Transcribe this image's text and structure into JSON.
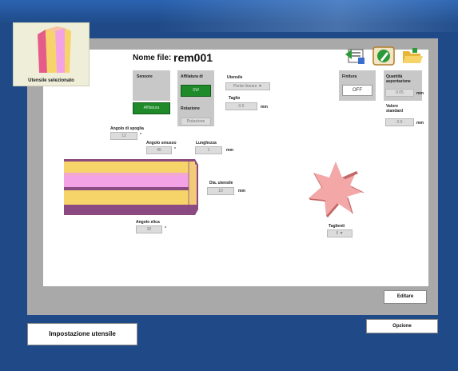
{
  "header": {
    "nome_file_label": "Nome file:",
    "nome_file_value": "rem001",
    "tool_thumb_caption": "Utensile selezionato"
  },
  "toolbar_icons": [
    "export-icon",
    "edit-icon",
    "folder-icon"
  ],
  "sensore": {
    "label": "Sensore",
    "button": "Affilatura"
  },
  "affilatura": {
    "label": "Affilatura di",
    "button": "SW"
  },
  "rotazione": {
    "label": "Rotazione",
    "value": "Rotazione"
  },
  "utensile": {
    "label": "Utensile",
    "value": "Punte lineare ▼"
  },
  "taglio": {
    "label": "Taglio",
    "value": "0.0",
    "unit": "mm"
  },
  "finitura": {
    "label": "Finitura",
    "button": "OFF"
  },
  "quantita": {
    "label": "Quantità asportazione",
    "value": "0.05",
    "unit": "mm"
  },
  "valore_standard": {
    "label": "Valore standard",
    "value": "0.0",
    "unit": "mm"
  },
  "angolo_spoglia": {
    "label": "Angolo di spoglia",
    "value": "12",
    "unit": "°"
  },
  "angolo_smusso": {
    "label": "Angolo smusso",
    "value": "45",
    "unit": "°"
  },
  "lunghezza": {
    "label": "Lunghezza",
    "value": "1",
    "unit": "mm"
  },
  "dia_utensile": {
    "label": "Dia. utensile",
    "value": "10",
    "unit": "mm"
  },
  "angolo_elica": {
    "label": "Angolo elica",
    "value": "30",
    "unit": "°"
  },
  "taglienti": {
    "label": "Taglienti",
    "value": "6 ▼"
  },
  "buttons": {
    "editare": "Editare",
    "opzione": "Opzione",
    "impostazione": "Impostazione utensile"
  },
  "colors": {
    "frame": "#a9a9a9",
    "green": "#1f8a2a",
    "tool_yellow": "#f6d46a",
    "tool_pink": "#f4a2e6",
    "tool_purple": "#8b4a82",
    "star": "#f4a7a7"
  }
}
